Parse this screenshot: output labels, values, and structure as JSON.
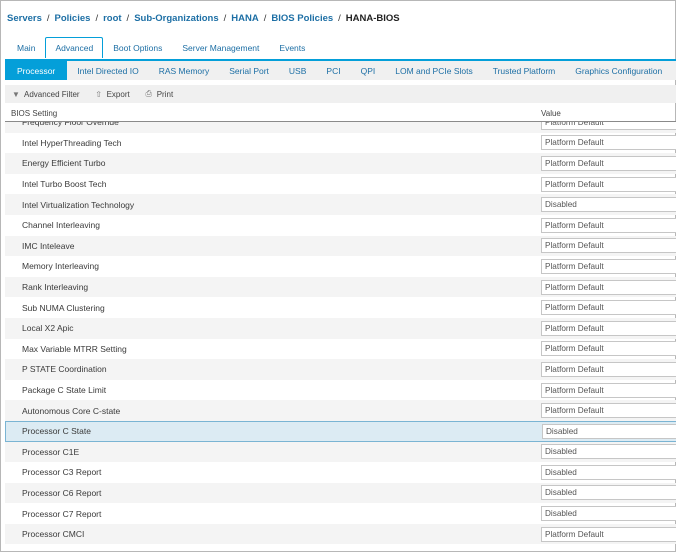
{
  "breadcrumb": {
    "items": [
      "Servers",
      "Policies",
      "root",
      "Sub-Organizations",
      "HANA",
      "BIOS Policies"
    ],
    "current": "HANA-BIOS",
    "separator": "/"
  },
  "tabs": [
    {
      "label": "Main",
      "active": false
    },
    {
      "label": "Advanced",
      "active": true
    },
    {
      "label": "Boot Options",
      "active": false
    },
    {
      "label": "Server Management",
      "active": false
    },
    {
      "label": "Events",
      "active": false
    }
  ],
  "subtabs": [
    {
      "label": "Processor",
      "active": true
    },
    {
      "label": "Intel Directed IO",
      "active": false
    },
    {
      "label": "RAS Memory",
      "active": false
    },
    {
      "label": "Serial Port",
      "active": false
    },
    {
      "label": "USB",
      "active": false
    },
    {
      "label": "PCI",
      "active": false
    },
    {
      "label": "QPI",
      "active": false
    },
    {
      "label": "LOM and PCIe Slots",
      "active": false
    },
    {
      "label": "Trusted Platform",
      "active": false
    },
    {
      "label": "Graphics Configuration",
      "active": false
    }
  ],
  "toolbar": {
    "advanced_filter": "Advanced Filter",
    "export": "Export",
    "print": "Print"
  },
  "table": {
    "col_setting": "BIOS Setting",
    "col_value": "Value",
    "rows": [
      {
        "setting": "Frequency Floor Override",
        "value": "Platform Default"
      },
      {
        "setting": "Intel HyperThreading Tech",
        "value": "Platform Default"
      },
      {
        "setting": "Energy Efficient Turbo",
        "value": "Platform Default"
      },
      {
        "setting": "Intel Turbo Boost Tech",
        "value": "Platform Default"
      },
      {
        "setting": "Intel Virtualization Technology",
        "value": "Disabled"
      },
      {
        "setting": "Channel Interleaving",
        "value": "Platform Default"
      },
      {
        "setting": "IMC Inteleave",
        "value": "Platform Default"
      },
      {
        "setting": "Memory Interleaving",
        "value": "Platform Default"
      },
      {
        "setting": "Rank Interleaving",
        "value": "Platform Default"
      },
      {
        "setting": "Sub NUMA Clustering",
        "value": "Platform Default"
      },
      {
        "setting": "Local X2 Apic",
        "value": "Platform Default"
      },
      {
        "setting": "Max Variable MTRR Setting",
        "value": "Platform Default"
      },
      {
        "setting": "P STATE Coordination",
        "value": "Platform Default"
      },
      {
        "setting": "Package C State Limit",
        "value": "Platform Default"
      },
      {
        "setting": "Autonomous Core C-state",
        "value": "Platform Default"
      },
      {
        "setting": "Processor C State",
        "value": "Disabled",
        "selected": true
      },
      {
        "setting": "Processor C1E",
        "value": "Disabled"
      },
      {
        "setting": "Processor C3 Report",
        "value": "Disabled"
      },
      {
        "setting": "Processor C6 Report",
        "value": "Disabled"
      },
      {
        "setting": "Processor C7 Report",
        "value": "Disabled"
      },
      {
        "setting": "Processor CMCI",
        "value": "Platform Default"
      }
    ]
  },
  "colors": {
    "accent": "#049fd9",
    "link": "#1d6fa5",
    "selected_row": "#dcebf3"
  }
}
